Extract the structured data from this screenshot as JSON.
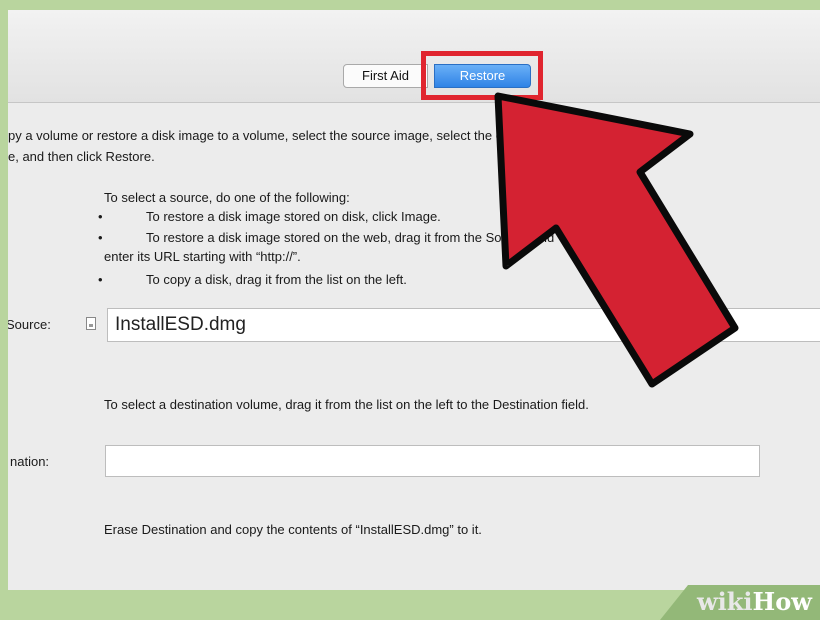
{
  "tabs": {
    "first_aid": "First Aid",
    "restore": "Restore"
  },
  "intro": {
    "line1": "py a volume or restore a disk image to a volume, select the source image, select the de",
    "line2": "e, and then click Restore."
  },
  "source_help": {
    "heading": "To select a source, do one of the following:",
    "bullet1": "To restore a disk image stored on disk, click Image.",
    "bullet2": "To restore a disk image stored on the web, drag it from the Source field",
    "bullet2_cont": "enter its URL starting with “http://”.",
    "bullet3": "To copy a disk, drag it from the list on the left.",
    "bullet_symbol": "•"
  },
  "source": {
    "label": "Source:",
    "value": "InstallESD.dmg",
    "icon": "document-icon"
  },
  "destination": {
    "help": "To select a destination volume, drag it from the list on the left to the Destination field.",
    "label": "nation:",
    "value": ""
  },
  "erase_note": "Erase Destination and copy the contents of “InstallESD.dmg” to it.",
  "watermark": {
    "wiki": "wiki",
    "how": "How"
  },
  "colors": {
    "highlight": "#e0252f",
    "arrow": "#d42232",
    "accent": "#3b8ef0",
    "frame": "#b9d59e"
  }
}
